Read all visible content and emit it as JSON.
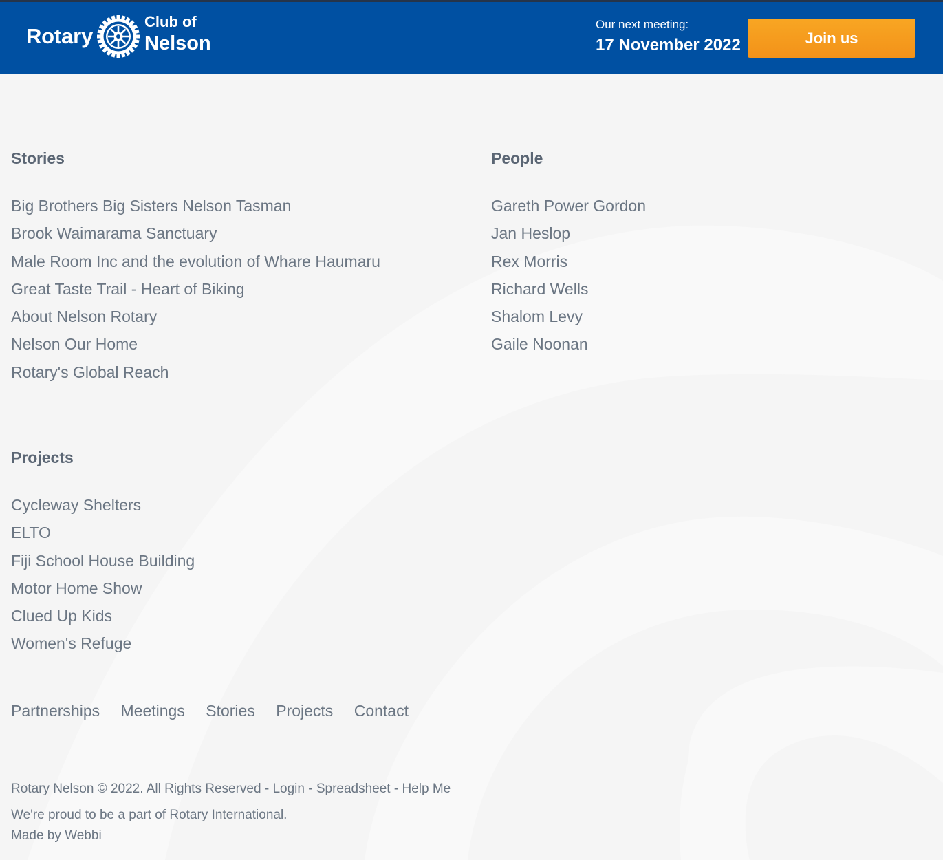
{
  "header": {
    "brand_rotary": "Rotary",
    "club_of": "Club of",
    "club_name": "Nelson",
    "meeting_label": "Our next meeting:",
    "meeting_date": "17 November 2022",
    "join_label": "Join us"
  },
  "stories": {
    "heading": "Stories",
    "items": [
      "Big Brothers Big Sisters Nelson Tasman",
      "Brook Waimarama Sanctuary",
      "Male Room Inc and the evolution of Whare Haumaru",
      "Great Taste Trail - Heart of Biking",
      "About Nelson Rotary",
      "Nelson Our Home",
      "Rotary's Global Reach"
    ]
  },
  "people": {
    "heading": "People",
    "items": [
      "Gareth Power Gordon",
      "Jan Heslop",
      "Rex Morris",
      "Richard Wells",
      "Shalom Levy",
      "Gaile Noonan"
    ]
  },
  "projects": {
    "heading": "Projects",
    "items": [
      "Cycleway Shelters",
      "ELTO",
      "Fiji School House Building",
      "Motor Home Show",
      "Clued Up Kids",
      "Women's Refuge"
    ]
  },
  "footer_nav": [
    "Partnerships",
    "Meetings",
    "Stories",
    "Projects",
    "Contact"
  ],
  "footer": {
    "copyright": "Rotary Nelson © 2022. All Rights Reserved",
    "sep": " - ",
    "login": "Login",
    "spreadsheet": "Spreadsheet",
    "help": "Help Me",
    "proud": "We're proud to be a part of Rotary International.",
    "made_by": "Made by Webbi"
  },
  "colors": {
    "header_bg": "#0050a2",
    "accent": "#f7a21d",
    "page_bg": "#f5f5f5",
    "text": "#6b7683"
  },
  "icons": [
    "rotary-wheel-icon"
  ]
}
